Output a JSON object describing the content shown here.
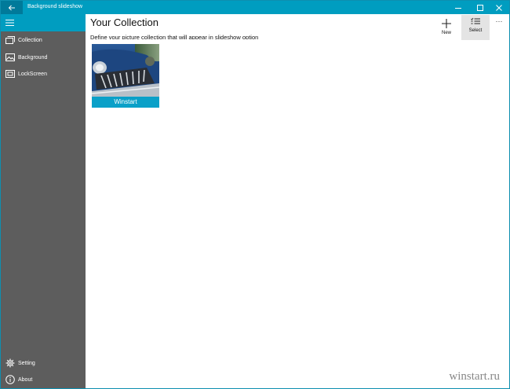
{
  "window": {
    "title": "Background slideshow"
  },
  "sidebar": {
    "items": [
      {
        "label": "Collection",
        "icon": "collection-icon"
      },
      {
        "label": "Background",
        "icon": "image-icon"
      },
      {
        "label": "LockScreen",
        "icon": "lockscreen-icon"
      }
    ],
    "footer": [
      {
        "label": "Setting",
        "icon": "gear-icon"
      },
      {
        "label": "About",
        "icon": "info-icon"
      }
    ]
  },
  "main": {
    "title": "Your Collection",
    "subtitle": "Define your picture collection that will appear in slideshow option",
    "commands": {
      "new_label": "New",
      "select_label": "Select",
      "more_label": "···"
    },
    "collection": [
      {
        "caption": "Winstart"
      }
    ]
  },
  "watermark": "winstart.ru",
  "colors": {
    "accent": "#009dc0",
    "sidebar": "#5d5d5d",
    "tile_caption": "#0aa0c8"
  }
}
